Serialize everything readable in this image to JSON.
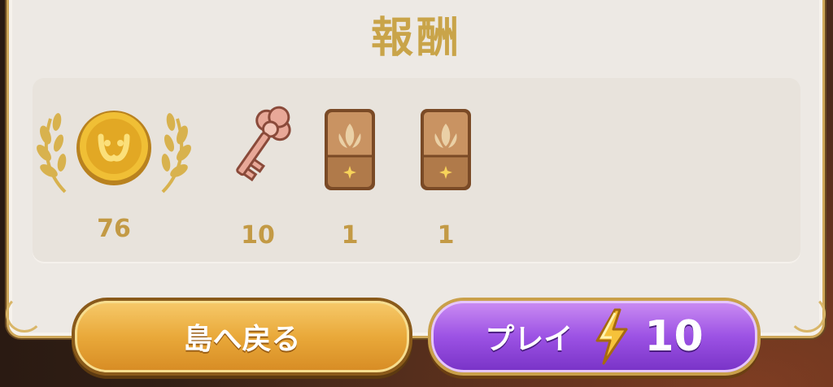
{
  "header": {
    "title": "報酬"
  },
  "rewards": [
    {
      "icon": "gold-coin-icon",
      "count": "76",
      "highlighted": true
    },
    {
      "icon": "key-icon",
      "count": "10"
    },
    {
      "icon": "card-pack-icon",
      "count": "1"
    },
    {
      "icon": "card-pack-icon",
      "count": "1"
    }
  ],
  "buttons": {
    "back_label": "島へ戻る",
    "play_label": "プレイ",
    "play_cost": "10",
    "play_cost_icon": "lightning-icon"
  },
  "colors": {
    "gold_text": "#c9a449",
    "panel_bg": "#ede9e4",
    "back_button": "#e9a93a",
    "play_button": "#9c52e4"
  }
}
